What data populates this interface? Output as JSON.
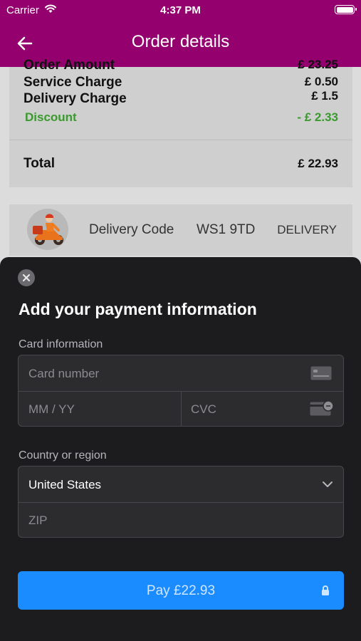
{
  "status_bar": {
    "carrier": "Carrier",
    "time": "4:37 PM"
  },
  "nav": {
    "title": "Order details"
  },
  "summary": {
    "order_amount_label": "Order Amount",
    "order_amount_value": "£ 23.25",
    "service_label": "Service Charge",
    "service_value": "£ 0.50",
    "delivery_label": "Delivery Charge",
    "delivery_value": "£ 1.5",
    "discount_label": "Discount",
    "discount_value": "- £ 2.33",
    "total_label": "Total",
    "total_value": "£ 22.93"
  },
  "delivery": {
    "code_label": "Delivery Code",
    "code_value": "WS1 9TD",
    "type": "DELIVERY"
  },
  "payment_sheet": {
    "heading": "Add your payment information",
    "card_info_label": "Card information",
    "card_number_placeholder": "Card number",
    "expiry_placeholder": "MM / YY",
    "cvc_placeholder": "CVC",
    "country_label": "Country or region",
    "country_value": "United States",
    "zip_placeholder": "ZIP",
    "pay_label": "Pay £22.93"
  },
  "colors": {
    "brand": "#94006e",
    "pay_button": "#1a8cff",
    "discount": "#3a9a2e",
    "sheet_background": "#1c1c1e"
  },
  "icons": [
    "wifi-icon",
    "battery-icon",
    "back-arrow-icon",
    "delivery-scooter-icon",
    "close-icon",
    "card-icon",
    "cvc-card-icon",
    "chevron-down-icon",
    "lock-icon"
  ]
}
